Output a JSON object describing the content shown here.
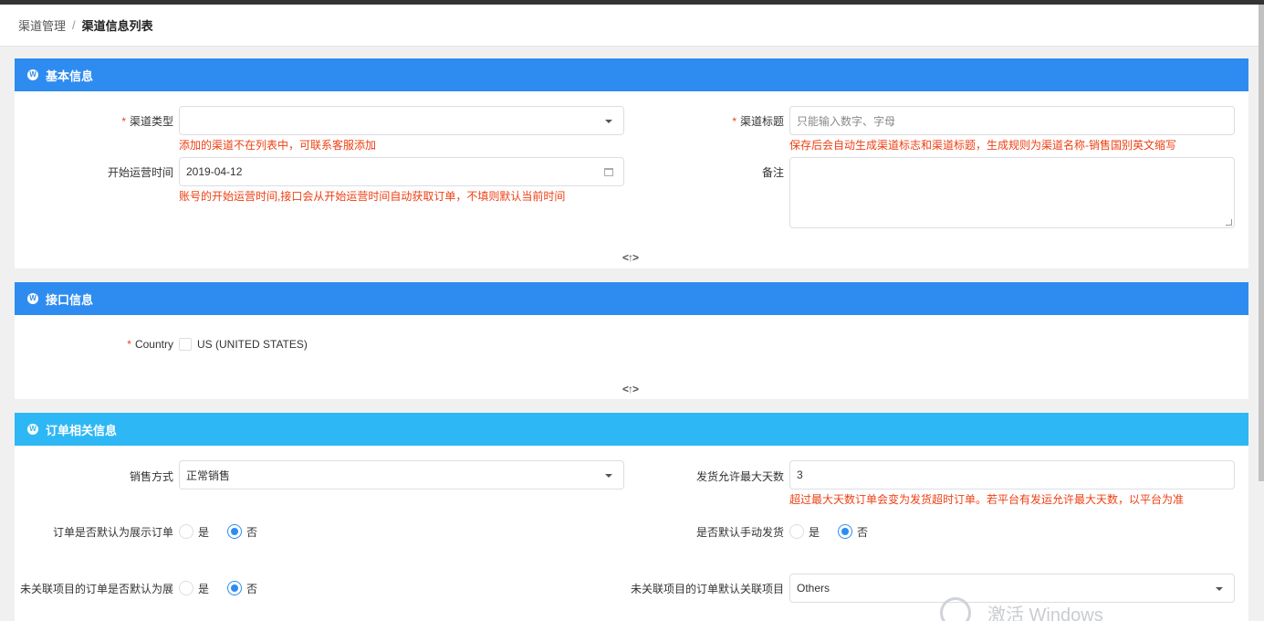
{
  "breadcrumb": {
    "parent": "渠道管理",
    "separator": "/",
    "current": "渠道信息列表"
  },
  "sections": {
    "basic": {
      "title": "基本信息",
      "channel_type_label": "渠道类型",
      "channel_type_value": "",
      "channel_type_hint": "添加的渠道不在列表中，可联系客服添加",
      "channel_title_label": "渠道标题",
      "channel_title_placeholder": "只能输入数字、字母",
      "channel_title_hint": "保存后会自动生成渠道标志和渠道标题，生成规则为渠道名称-销售国别英文缩写",
      "start_time_label": "开始运营时间",
      "start_time_value": "2019-04-12",
      "start_time_hint": "账号的开始运营时间,接口会从开始运营时间自动获取订单，不填则默认当前时间",
      "remark_label": "备注",
      "collapse": "<↑>"
    },
    "api": {
      "title": "接口信息",
      "country_label": "Country",
      "country_option": "US (UNITED STATES)",
      "collapse": "<↑>"
    },
    "order": {
      "title": "订单相关信息",
      "sale_mode_label": "销售方式",
      "sale_mode_value": "正常销售",
      "max_days_label": "发货允许最大天数",
      "max_days_value": "3",
      "max_days_hint": "超过最大天数订单会变为发货超时订单。若平台有发运允许最大天数，以平台为准",
      "default_display_label": "订单是否默认为展示订单",
      "default_manual_label": "是否默认手动发货",
      "unlinked_display_label": "未关联项目的订单是否默认为展",
      "unlinked_project_label": "未关联项目的订单默认关联项目",
      "unlinked_project_value": "Others",
      "yes": "是",
      "no": "否"
    }
  },
  "watermark": "激活 Windows",
  "colors": {
    "primary": "#2e8cf0",
    "info": "#2db7f5",
    "error": "#ed4014"
  }
}
